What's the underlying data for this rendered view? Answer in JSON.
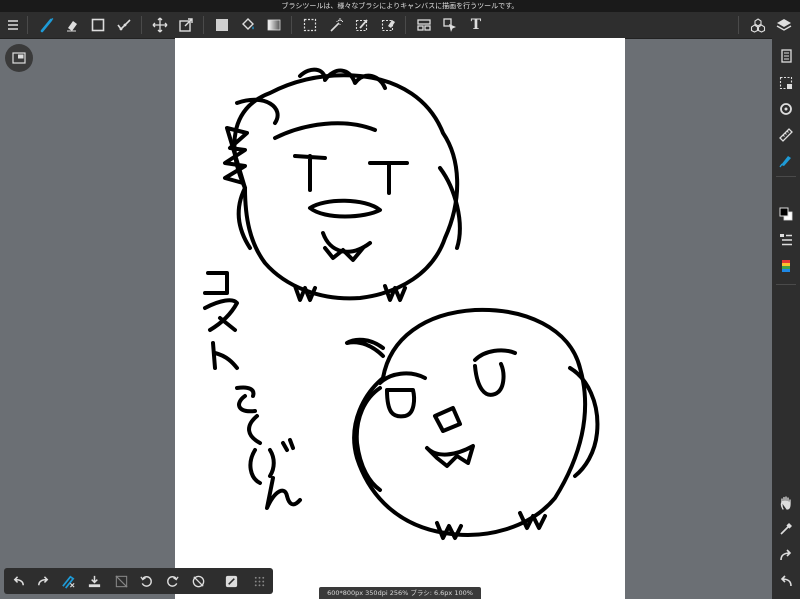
{
  "status_bar": {
    "text": "ブラシツールは、様々なブラシによりキャンバスに描画を行うツールです。"
  },
  "top_toolbar": {
    "tools": [
      {
        "name": "menu-icon"
      },
      {
        "name": "brush-icon",
        "active": true
      },
      {
        "name": "eraser-icon"
      },
      {
        "name": "rectangle-shape-icon"
      },
      {
        "name": "vector-smooth-icon"
      },
      {
        "name": "move-icon"
      },
      {
        "name": "transform-icon"
      },
      {
        "name": "fill-color-icon"
      },
      {
        "name": "bucket-icon"
      },
      {
        "name": "gradient-icon"
      },
      {
        "name": "select-rect-icon"
      },
      {
        "name": "magic-wand-icon"
      },
      {
        "name": "select-pen-icon"
      },
      {
        "name": "select-eraser-icon"
      },
      {
        "name": "frame-icon"
      },
      {
        "name": "operation-icon"
      },
      {
        "name": "text-icon"
      },
      {
        "name": "materials-icon"
      },
      {
        "name": "layers-icon"
      }
    ],
    "text_tool_label": "T"
  },
  "right_panel": {
    "items": [
      "page-icon",
      "select-layer-icon",
      "rotate-icon",
      "ruler-icon",
      "pen-ink-icon",
      "color-swatch-icon",
      "brush-list-icon",
      "palette-icon",
      "hand-icon",
      "eyedropper-icon",
      "redo-icon",
      "undo-icon"
    ]
  },
  "bottom_toolbar": {
    "items": [
      "undo-icon",
      "redo-icon",
      "clear-icon",
      "import-icon",
      "deselect-icon",
      "rotate-left-icon",
      "rotate-right-icon",
      "flip-icon",
      "snap-icon",
      "grid-icon"
    ]
  },
  "info_bar": {
    "text": "600*800px 350dpi 256% ブラシ: 6.6px 100%"
  },
  "colors": {
    "accent": "#1e9bd7",
    "toolbar": "#2e2e2e",
    "workspace": "#6b6f74",
    "canvas": "#ffffff"
  }
}
